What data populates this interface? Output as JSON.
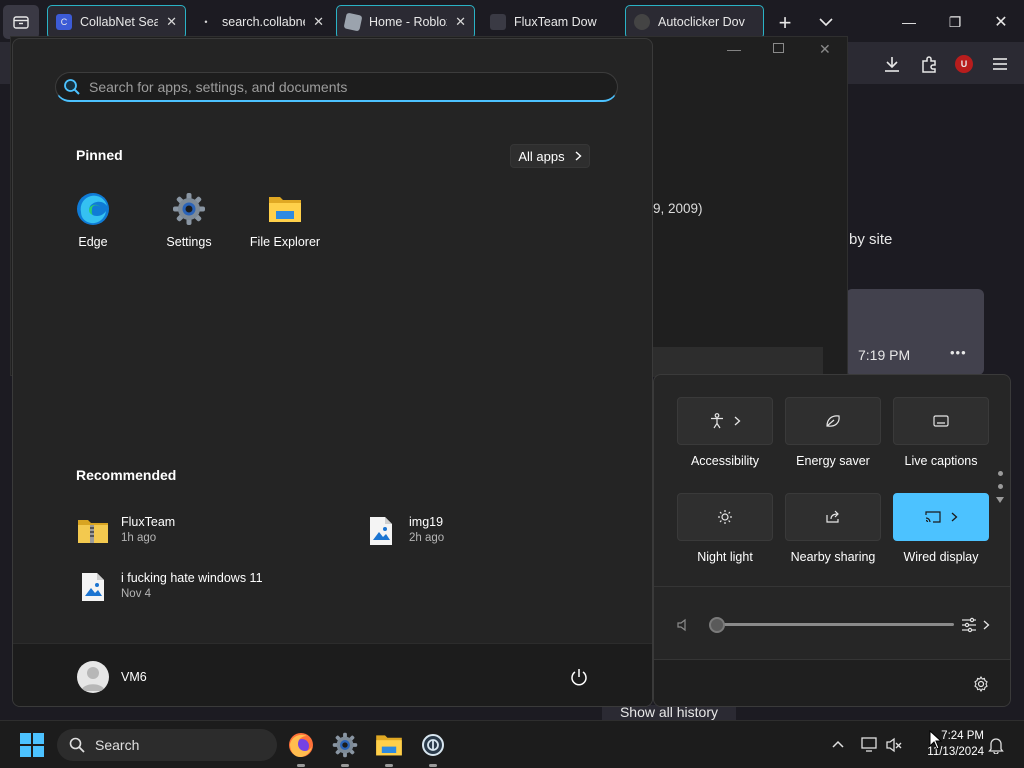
{
  "browser": {
    "tabs": [
      {
        "title": "CollabNet Sear",
        "close": "✕"
      },
      {
        "title": "search.collabne",
        "close": "✕"
      },
      {
        "title": "Home - Roblox",
        "close": "✕"
      },
      {
        "title": "FluxTeam Dow",
        "close": "✕"
      },
      {
        "title": "Autoclicker Dov",
        "close": "✕"
      }
    ],
    "new_tab": "+",
    "list_all_tabs": "⌄",
    "window_controls": {
      "minimize": "—",
      "maximize": "❐",
      "close": "✕"
    },
    "ext_badge": "U",
    "content_snippets": {
      "date_fragment": "9, 2009)",
      "by_site": "by site",
      "card_time": "7:19 PM",
      "card_more": "•••",
      "show_history": "Show all history"
    }
  },
  "start_menu": {
    "search_placeholder": "Search for apps, settings, and documents",
    "pinned_title": "Pinned",
    "all_apps_label": "All apps",
    "pinned": [
      {
        "label": "Edge",
        "icon": "edge-icon"
      },
      {
        "label": "Settings",
        "icon": "gear-icon"
      },
      {
        "label": "File Explorer",
        "icon": "folder-icon"
      }
    ],
    "recommended_title": "Recommended",
    "recommended": [
      {
        "name": "FluxTeam",
        "time": "1h ago",
        "icon": "zip-folder-icon"
      },
      {
        "name": "img19",
        "time": "2h ago",
        "icon": "image-file-icon"
      },
      {
        "name": "i fucking hate windows 11",
        "time": "Nov 4",
        "icon": "image-file-icon"
      }
    ],
    "user": "VM6"
  },
  "quick_settings": {
    "tiles": [
      {
        "label": "Accessibility",
        "icon": "accessibility-icon",
        "chevron": true,
        "on": false
      },
      {
        "label": "Energy saver",
        "icon": "leaf-icon",
        "chevron": false,
        "on": false
      },
      {
        "label": "Live captions",
        "icon": "captions-icon",
        "chevron": false,
        "on": false
      },
      {
        "label": "Night light",
        "icon": "sun-icon",
        "chevron": false,
        "on": false
      },
      {
        "label": "Nearby sharing",
        "icon": "share-icon",
        "chevron": false,
        "on": false
      },
      {
        "label": "Wired display",
        "icon": "cast-icon",
        "chevron": true,
        "on": true
      }
    ],
    "volume": 0
  },
  "taskbar": {
    "search_label": "Search",
    "time": "7:24 PM",
    "date": "11/13/2024"
  },
  "colors": {
    "accent": "#4cc2ff",
    "container_tab": "#2ab3c6"
  }
}
